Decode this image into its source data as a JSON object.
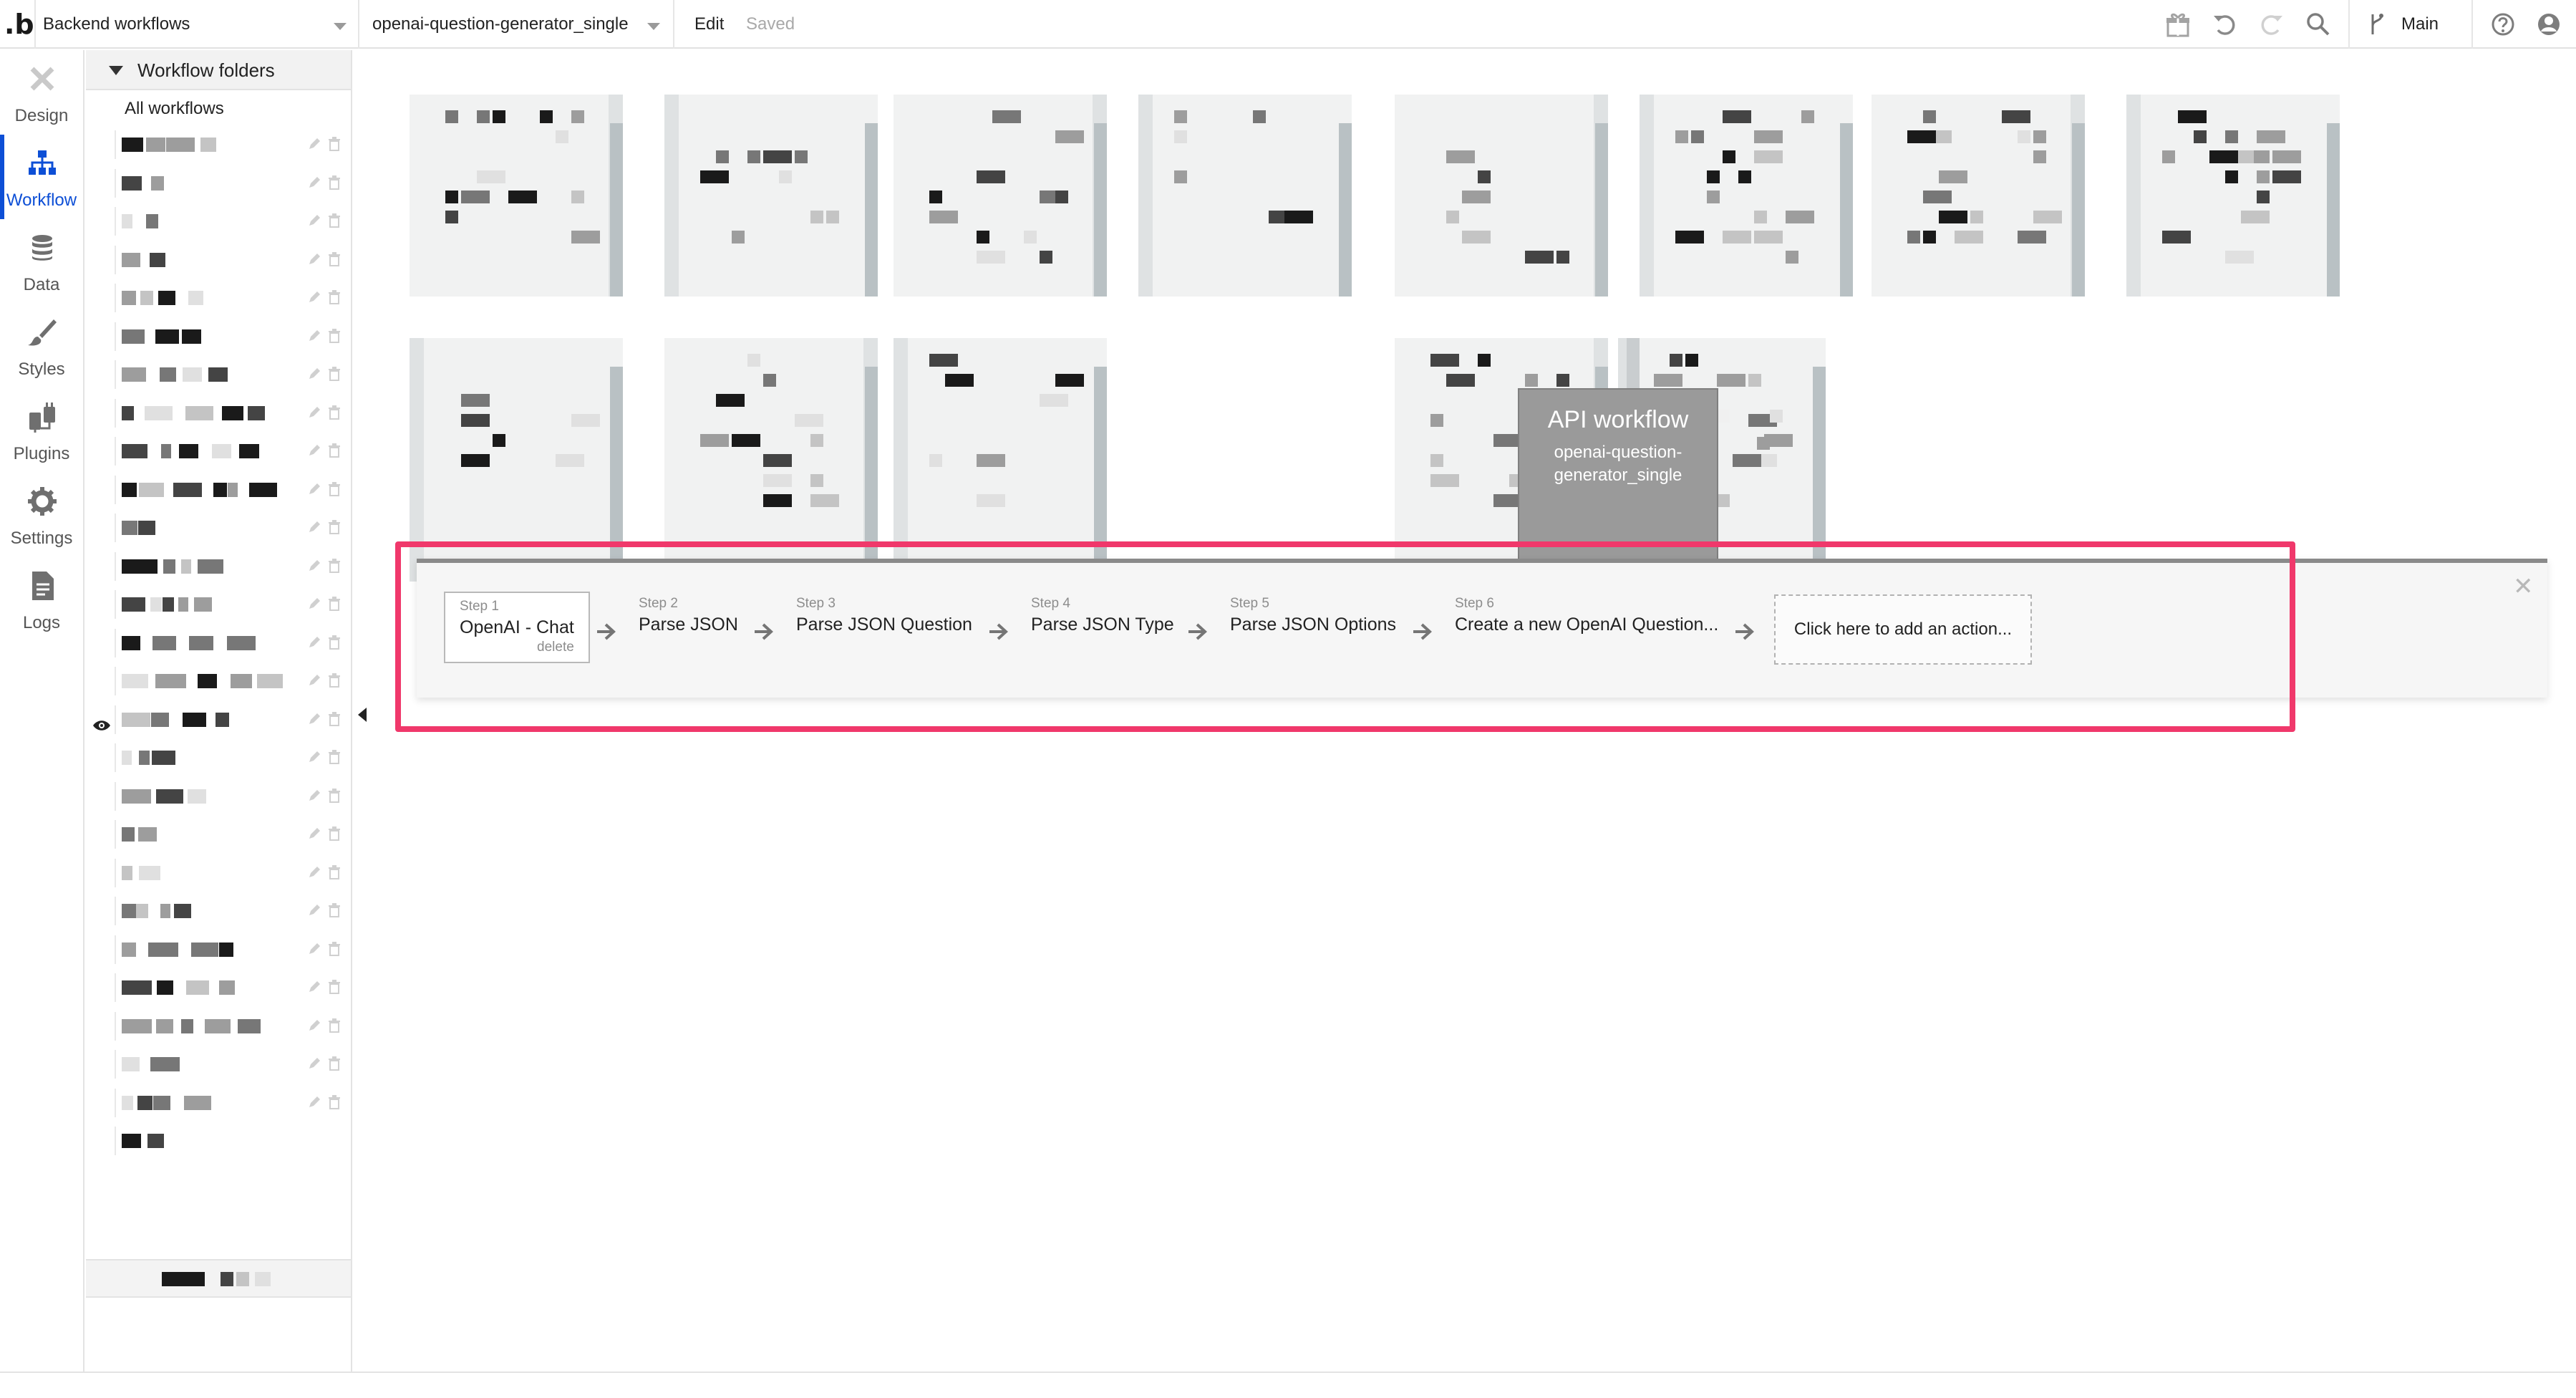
{
  "topbar": {
    "logo": ".b",
    "page_selector": "Backend workflows",
    "workflow_selector": "openai-question-generator_single",
    "edit_label": "Edit",
    "saved_label": "Saved",
    "branch_label": "Main"
  },
  "rail": {
    "items": [
      {
        "label": "Design",
        "icon": "design-icon"
      },
      {
        "label": "Workflow",
        "icon": "workflow-icon"
      },
      {
        "label": "Data",
        "icon": "database-icon"
      },
      {
        "label": "Styles",
        "icon": "brush-icon"
      },
      {
        "label": "Plugins",
        "icon": "plug-icon"
      },
      {
        "label": "Settings",
        "icon": "gear-icon"
      },
      {
        "label": "Logs",
        "icon": "document-icon"
      }
    ],
    "active": "Workflow"
  },
  "folders": {
    "title": "Workflow folders",
    "all_label": "All workflows"
  },
  "canvas": {
    "api_card": {
      "title": "API workflow",
      "subtitle": "openai-question-generator_single"
    }
  },
  "steps": {
    "items": [
      {
        "number": "Step 1",
        "name": "OpenAI - Chat",
        "delete_label": "delete"
      },
      {
        "number": "Step 2",
        "name": "Parse JSON"
      },
      {
        "number": "Step 3",
        "name": "Parse JSON Question"
      },
      {
        "number": "Step 4",
        "name": "Parse JSON Type"
      },
      {
        "number": "Step 5",
        "name": "Parse JSON Options"
      },
      {
        "number": "Step 6",
        "name": "Create a new OpenAI Question..."
      }
    ],
    "add_action_label": "Click here to add an action...",
    "close_icon": "close-icon"
  },
  "colors": {
    "accent": "#0d4fd6",
    "highlight": "#f0386b",
    "api_card": "#9a9a9a"
  }
}
